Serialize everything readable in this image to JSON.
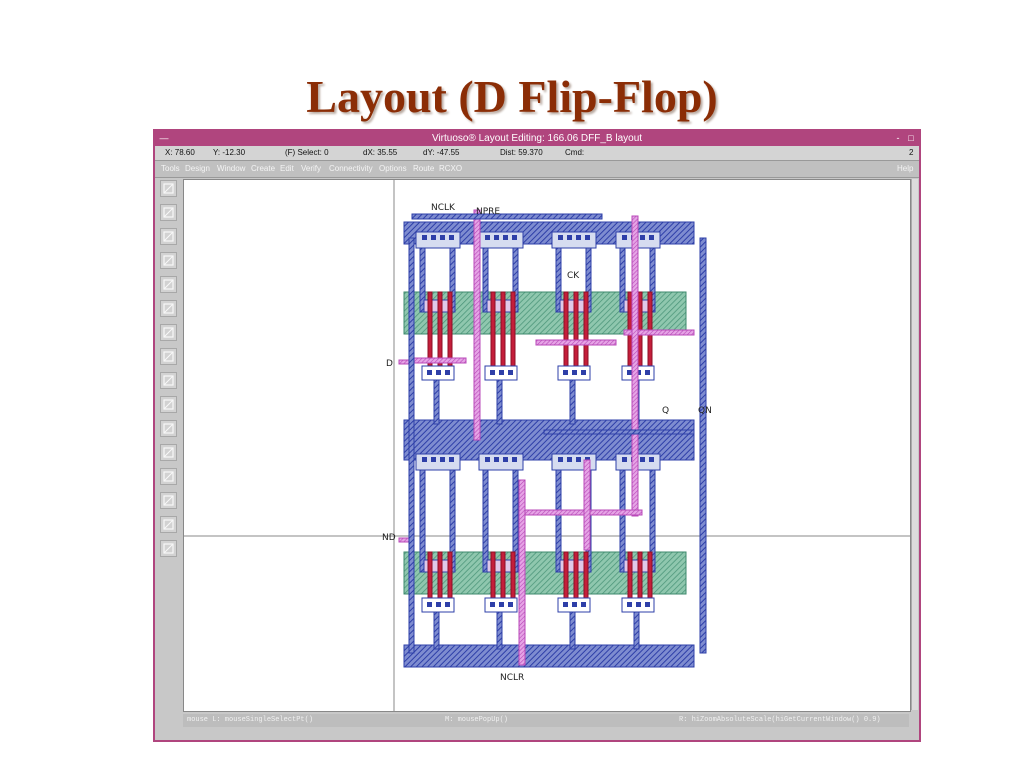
{
  "slide": {
    "title": "Layout (D Flip-Flop)"
  },
  "window": {
    "title": "Virtuoso® Layout Editing: 166.06 DFF_B layout",
    "close_glyph": "—",
    "btn_min": "-",
    "btn_max": "□"
  },
  "status": {
    "x": "X: 78.60",
    "y": "Y: -12.30",
    "select": "(F) Select: 0",
    "dx": "dX: 35.55",
    "dy": "dY: -47.55",
    "dist": "Dist: 59.370",
    "cmd": "Cmd:",
    "count": "2"
  },
  "menu": {
    "items": [
      "Tools",
      "Design",
      "Window",
      "Create",
      "Edit",
      "Verify",
      "Connectivity",
      "Options",
      "Route",
      "RCXO"
    ],
    "help": "Help"
  },
  "toolbar": {
    "tools": [
      "save-icon",
      "zoom-fit-icon",
      "zoom-in-icon",
      "zoom-out-icon",
      "stretch-icon",
      "copy-icon",
      "move-icon",
      "delete-icon",
      "undo-icon",
      "property-icon",
      "ruler-icon",
      "path-icon",
      "polygon-icon",
      "label-icon",
      "instance-icon",
      "line-icon"
    ]
  },
  "layout": {
    "labels": {
      "nclk": "NCLK",
      "npre": "NPRE",
      "ck": "CK",
      "d": "D",
      "q": "Q",
      "qn": "QN",
      "nd": "ND",
      "nclr": "NCLR"
    }
  },
  "cmdline": {
    "left": "mouse L: mouseSingleSelectPt()",
    "middle": "M: mousePopUp()",
    "right": "R: hiZoomAbsoluteScale(hiGetCurrentWindow() 0.9)"
  },
  "colors": {
    "accent": "#b0457e",
    "title": "#8b2d06",
    "metal1": "#2e3fa8",
    "poly": "#c41e3a",
    "diffusion": "#5aa48a",
    "metal2": "#c858c8"
  }
}
